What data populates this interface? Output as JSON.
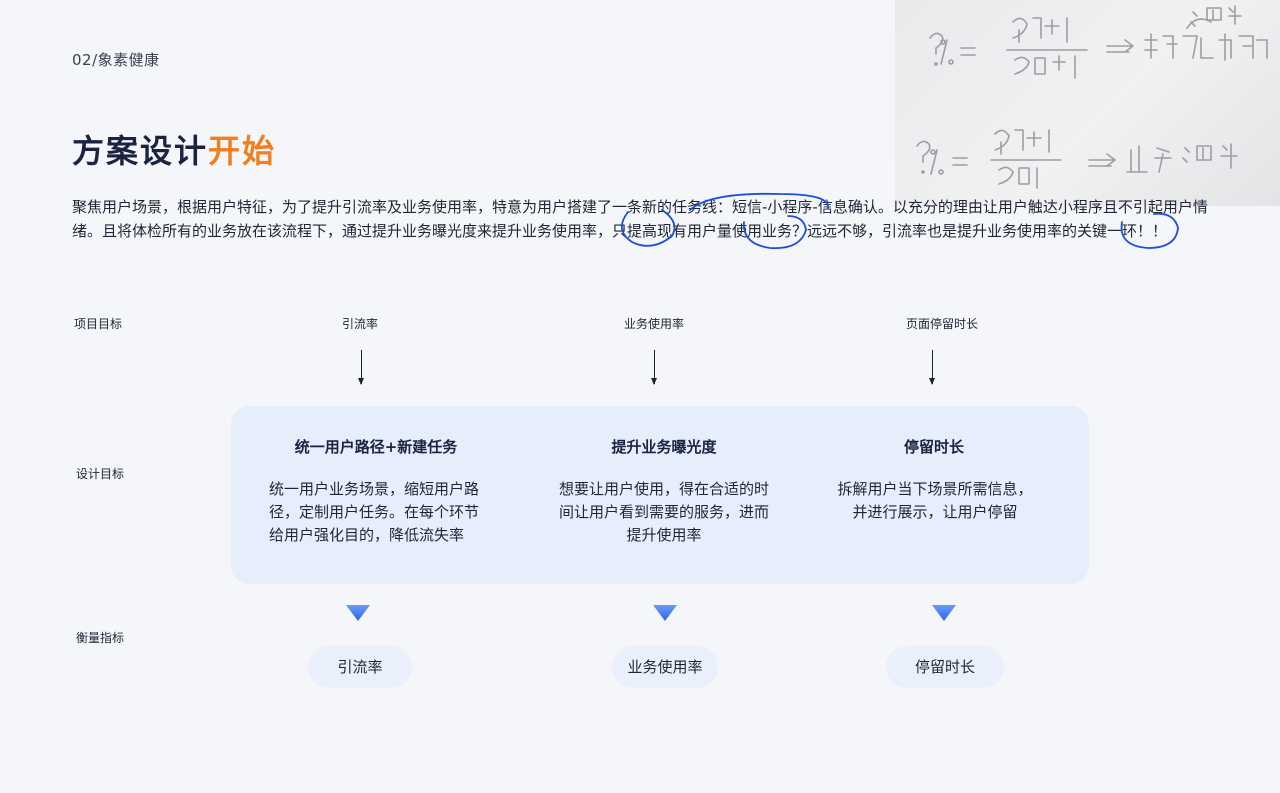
{
  "section_label": "02/象素健康",
  "title": {
    "main": "方案设计",
    "accent": "开始"
  },
  "intro": "聚焦用户场景，根据用户特征，为了提升引流率及业务使用率，特意为用户搭建了一条新的任务线：短信-小程序-信息确认。以充分的理由让用户触达小程序且不引起用户情绪。且将体检所有的业务放在该流程下，通过提升业务曝光度来提升业务使用率，只提高现有用户量使用业务？远远不够，引流率也是提升业务使用率的关键一环！！",
  "row_labels": {
    "goal": "项目目标",
    "design": "设计目标",
    "metric": "衡量指标"
  },
  "goals": [
    "引流率",
    "业务使用率",
    "页面停留时长"
  ],
  "design": [
    {
      "heading": "统一用户路径+新建任务",
      "desc": "统一用户业务场景，缩短用户路径，定制用户任务。在每个环节给用户强化目的，降低流失率"
    },
    {
      "heading": "提升业务曝光度",
      "desc": "想要让用户使用，得在合适的时间让用户看到需要的服务，进而提升使用率"
    },
    {
      "heading": "停留时长",
      "desc": "拆解用户当下场景所需信息，并进行展示，让用户停留"
    }
  ],
  "metrics": [
    "引流率",
    "业务使用率",
    "停留时长"
  ],
  "handwritten_note": [
    "?% = 分子+1 / 分母+1 ⇒ 短信触达用户 漏斗",
    "?% = 分子+1 / 分母 ⇒ 业务漏斗"
  ],
  "colors": {
    "accent": "#f07f1c",
    "panel": "#e6eefc",
    "annotation": "#1d4fd8",
    "triangle": "#3d7bf2"
  }
}
